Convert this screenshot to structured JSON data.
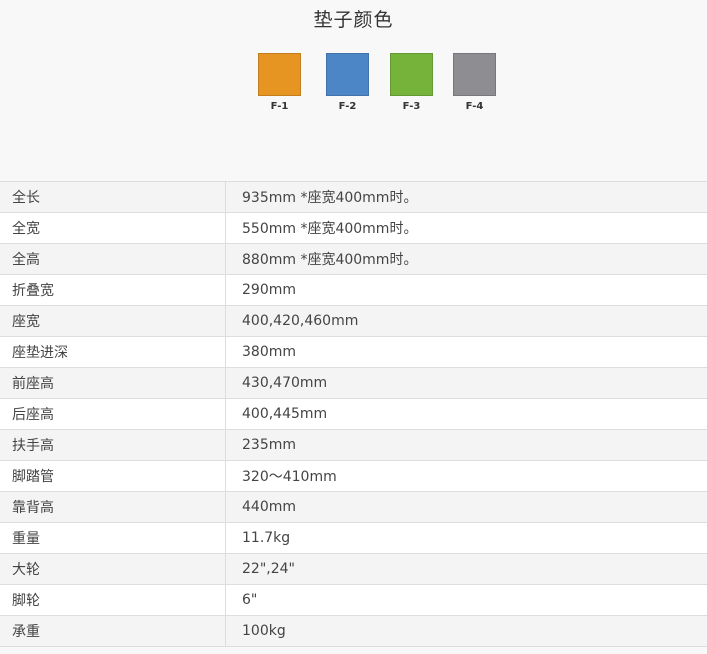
{
  "cushion_colors": {
    "title": "垫子颜色",
    "swatches": [
      {
        "label": "F-1",
        "color": "#e69523"
      },
      {
        "label": "F-2",
        "color": "#4d86c7"
      },
      {
        "label": "F-3",
        "color": "#76b33b"
      },
      {
        "label": "F-4",
        "color": "#8e8e92"
      }
    ]
  },
  "specs": [
    {
      "label": "全长",
      "value": "935mm *座宽400mm时。"
    },
    {
      "label": "全宽",
      "value": "550mm *座宽400mm时。"
    },
    {
      "label": "全高",
      "value": "880mm *座宽400mm时。"
    },
    {
      "label": "折叠宽",
      "value": "290mm"
    },
    {
      "label": "座宽",
      "value": "400,420,460mm"
    },
    {
      "label": "座垫进深",
      "value": "380mm"
    },
    {
      "label": "前座高",
      "value": "430,470mm"
    },
    {
      "label": "后座高",
      "value": "400,445mm"
    },
    {
      "label": "扶手高",
      "value": "235mm"
    },
    {
      "label": "脚踏管",
      "value": "320～410mm"
    },
    {
      "label": "靠背高",
      "value": "440mm"
    },
    {
      "label": "重量",
      "value": "11.7kg"
    },
    {
      "label": "大轮",
      "value": "22\",24\""
    },
    {
      "label": "脚轮",
      "value": "6\""
    },
    {
      "label": "承重",
      "value": "100kg"
    }
  ]
}
